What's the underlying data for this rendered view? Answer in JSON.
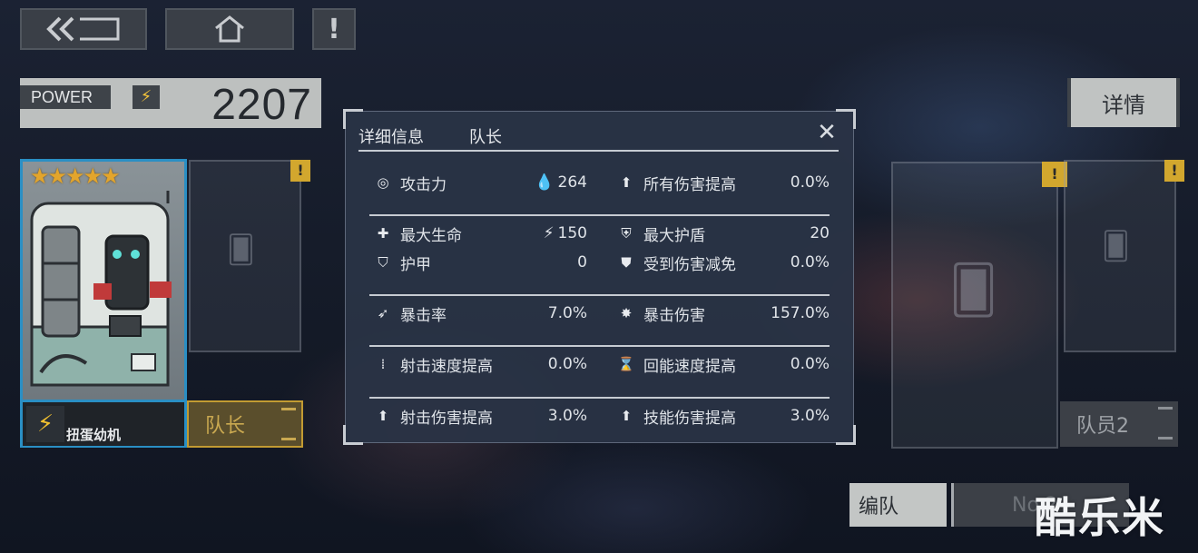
{
  "top": {
    "back_icon": "back-arrow-icon",
    "home_icon": "home-icon",
    "alert_label": "!"
  },
  "power": {
    "label": "POWER",
    "bolt": "⚡",
    "value": "2207"
  },
  "detail_button": "详情",
  "leader_card": {
    "stars": "★★★★★",
    "name": "扭蛋幼机",
    "bolt": "⚡",
    "tag": "队长"
  },
  "member2_tag": "队员2",
  "warn": "!",
  "modal": {
    "title": "详细信息",
    "subtitle": "队长",
    "rows": [
      [
        {
          "icon": "attack-icon",
          "glyph": "◎",
          "label": "攻击力",
          "prefix": "💧",
          "value": "264"
        },
        {
          "icon": "damage-up-icon",
          "glyph": "⬆",
          "label": "所有伤害提高",
          "prefix": "",
          "value": "0.0%"
        }
      ],
      [
        {
          "icon": "heart-plus-icon",
          "glyph": "✚",
          "label": "最大生命",
          "prefix": "⚡",
          "value": "150"
        },
        {
          "icon": "shield-bolt-icon",
          "glyph": "⛨",
          "label": "最大护盾",
          "prefix": "",
          "value": "20"
        }
      ],
      [
        {
          "icon": "armor-icon",
          "glyph": "⛉",
          "label": "护甲",
          "prefix": "",
          "value": "0"
        },
        {
          "icon": "damage-reduce-icon",
          "glyph": "⛊",
          "label": "受到伤害减免",
          "prefix": "",
          "value": "0.0%"
        }
      ],
      [
        {
          "icon": "crit-rate-icon",
          "glyph": "➶",
          "label": "暴击率",
          "prefix": "",
          "value": "7.0%"
        },
        {
          "icon": "crit-damage-icon",
          "glyph": "✸",
          "label": "暴击伤害",
          "prefix": "",
          "value": "157.0%"
        }
      ],
      [
        {
          "icon": "fire-rate-icon",
          "glyph": "⁞",
          "label": "射击速度提高",
          "prefix": "",
          "value": "0.0%"
        },
        {
          "icon": "energy-regen-icon",
          "glyph": "⌛",
          "label": "回能速度提高",
          "prefix": "",
          "value": "0.0%"
        }
      ],
      [
        {
          "icon": "shot-damage-icon",
          "glyph": "⬆",
          "label": "射击伤害提高",
          "prefix": "",
          "value": "3.0%"
        },
        {
          "icon": "skill-damage-icon",
          "glyph": "⬆",
          "label": "技能伤害提高",
          "prefix": "",
          "value": "3.0%"
        }
      ]
    ]
  },
  "bottom": {
    "formation": "编队",
    "no_label": "No.2"
  },
  "watermark": "酷乐米",
  "colors": {
    "accent_gold": "#d2a72e",
    "leader_blue": "#2a8fc4",
    "panel": "#2a3446"
  }
}
